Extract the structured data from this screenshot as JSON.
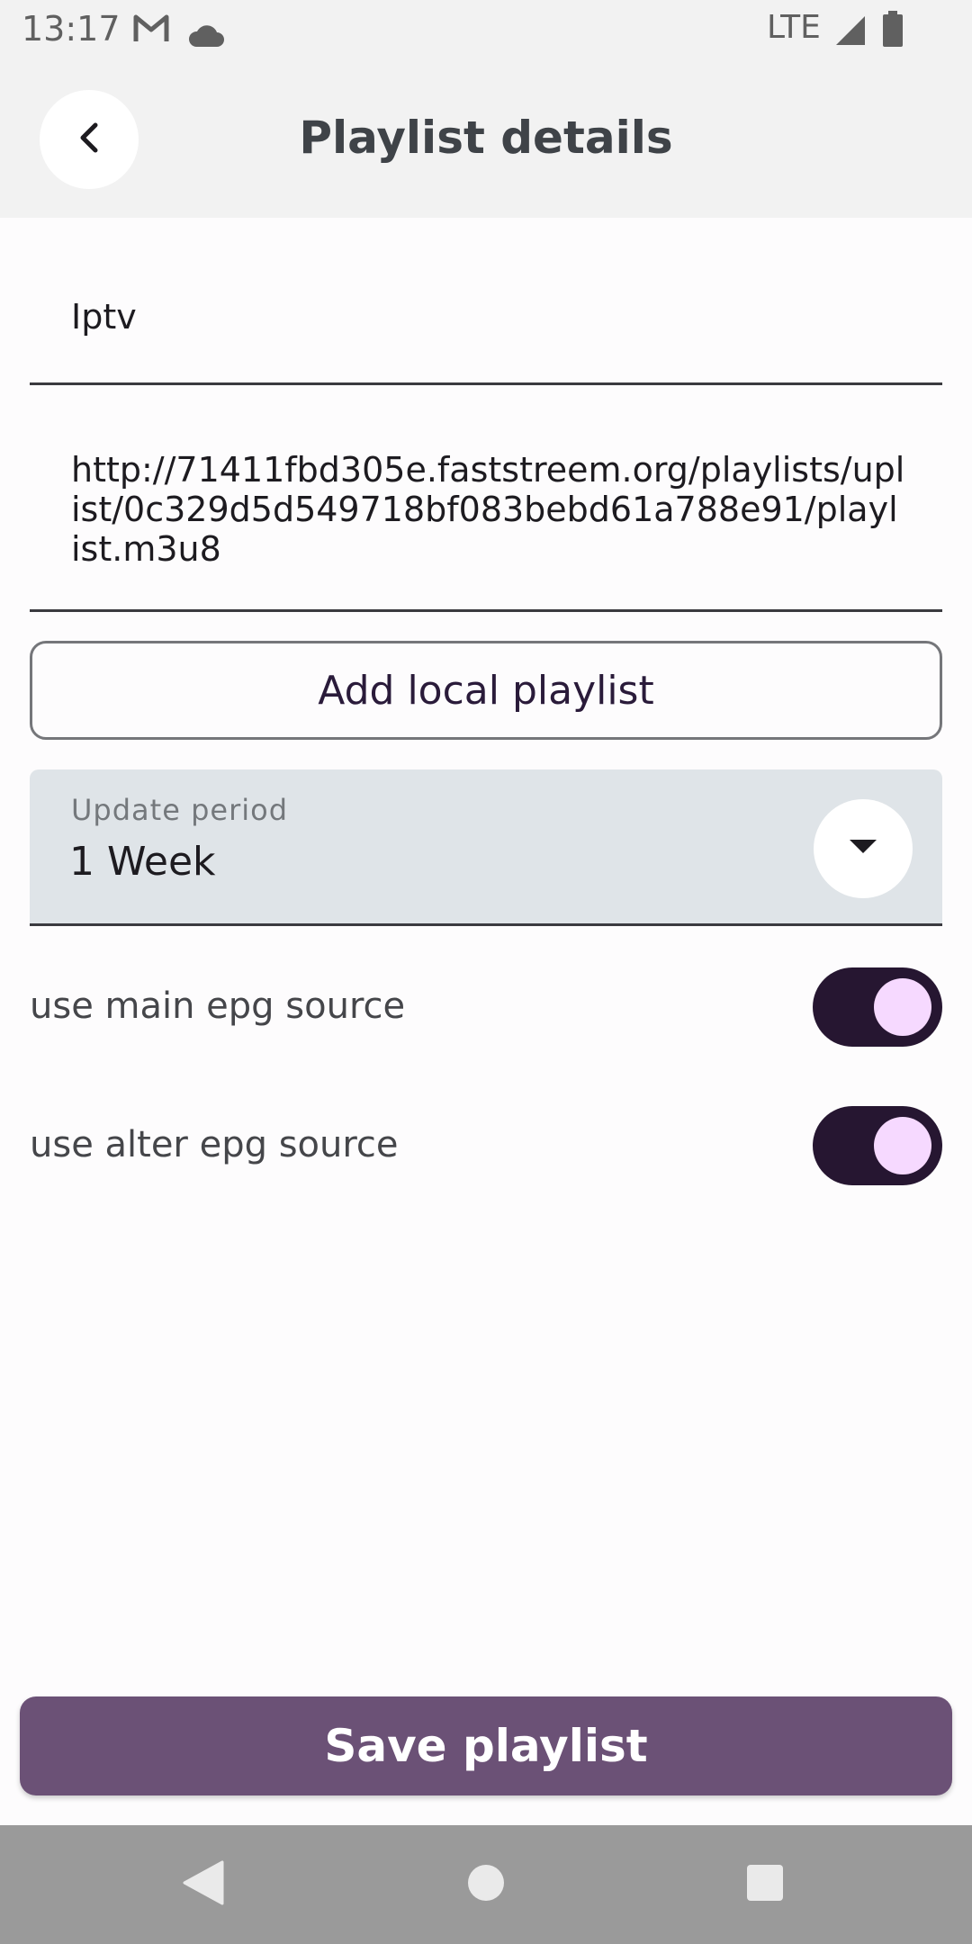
{
  "status_bar": {
    "time": "13:17",
    "network": "LTE",
    "icons": [
      "gmail-icon",
      "cloud-icon",
      "signal-icon",
      "battery-icon"
    ]
  },
  "header": {
    "title": "Playlist details",
    "back_icon": "chevron-left-icon"
  },
  "form": {
    "name_value": "Iptv",
    "url_value": "http://71411fbd305e.faststreem.org/playlists/uplist/0c329d5d549718bf083bebd61a788e91/playlist.m3u8",
    "add_local_label": "Add local playlist",
    "update_period": {
      "label": "Update period",
      "selected": "1 Week"
    },
    "toggles": [
      {
        "label": "use main epg source",
        "on": true
      },
      {
        "label": "use alter epg source",
        "on": true
      }
    ],
    "save_label": "Save playlist"
  },
  "colors": {
    "accent": "#6b5176",
    "toggle_track": "#261631",
    "toggle_knob": "#f6d9ff",
    "dropdown_bg": "#dfe4e8"
  }
}
